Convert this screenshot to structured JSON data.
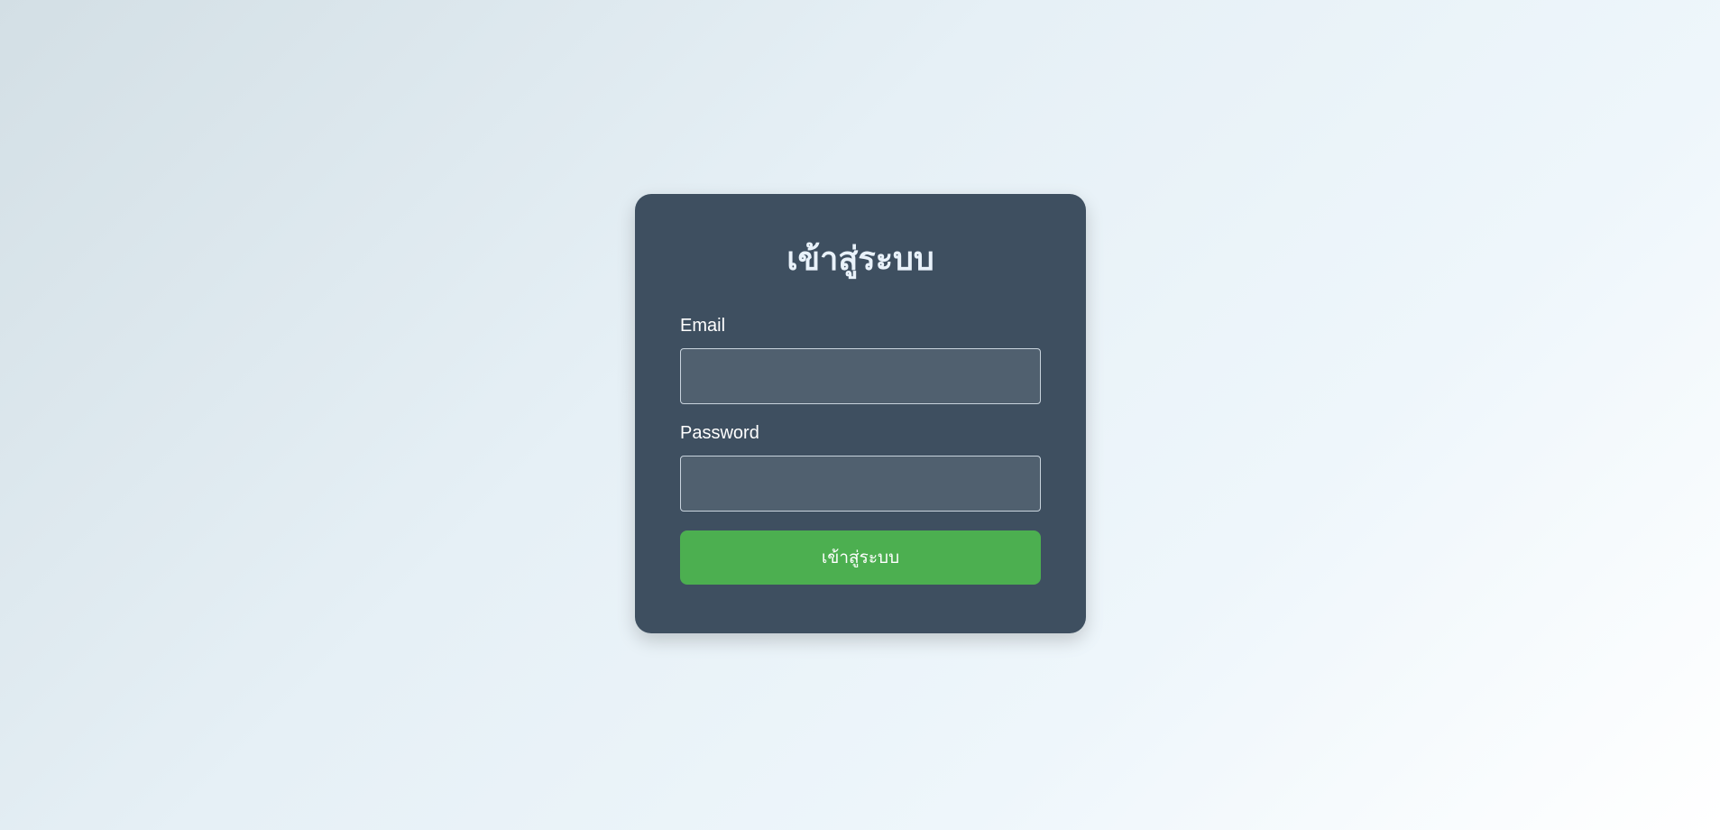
{
  "login": {
    "title": "เข้าสู่ระบบ",
    "email": {
      "label": "Email",
      "value": "",
      "placeholder": ""
    },
    "password": {
      "label": "Password",
      "value": "",
      "placeholder": ""
    },
    "submit_label": "เข้าสู่ระบบ"
  },
  "colors": {
    "card_background": "#3e4f60",
    "input_background": "#50606f",
    "submit_button": "#4caf50",
    "title_text": "#e9f2fa"
  }
}
